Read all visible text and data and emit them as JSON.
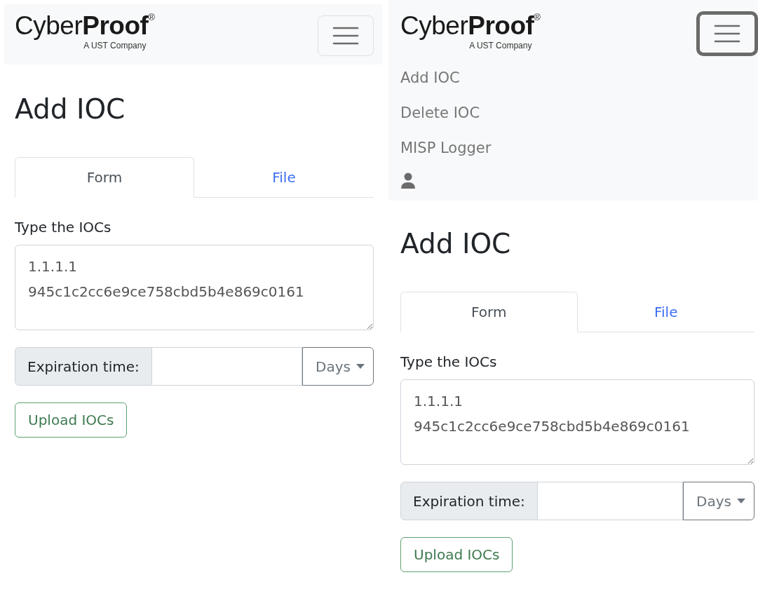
{
  "panels": [
    {
      "logo": {
        "light": "Cyber",
        "bold": "Proof",
        "mark": "®",
        "tagline": "A UST Company"
      },
      "menu": {
        "expanded": false
      },
      "title": "Add IOC",
      "tabs": [
        {
          "label": "Form",
          "selected": true
        },
        {
          "label": "File",
          "selected": false
        }
      ],
      "ioc_field": {
        "label": "Type the IOCs",
        "value": "1.1.1.1\n945c1c2cc6e9ce758cbd5b4e869c0161"
      },
      "expiration": {
        "label": "Expiration time:",
        "unit": "Days"
      },
      "upload_button": "Upload IOCs"
    },
    {
      "logo": {
        "light": "Cyber",
        "bold": "Proof",
        "mark": "®",
        "tagline": "A UST Company"
      },
      "menu": {
        "expanded": true,
        "items": [
          "Add IOC",
          "Delete IOC",
          "MISP Logger"
        ]
      },
      "title": "Add IOC",
      "tabs": [
        {
          "label": "Form",
          "selected": true
        },
        {
          "label": "File",
          "selected": false
        }
      ],
      "ioc_field": {
        "label": "Type the IOCs",
        "value": "1.1.1.1\n945c1c2cc6e9ce758cbd5b4e869c0161"
      },
      "expiration": {
        "label": "Expiration time:",
        "unit": "Days"
      },
      "upload_button": "Upload IOCs"
    }
  ]
}
